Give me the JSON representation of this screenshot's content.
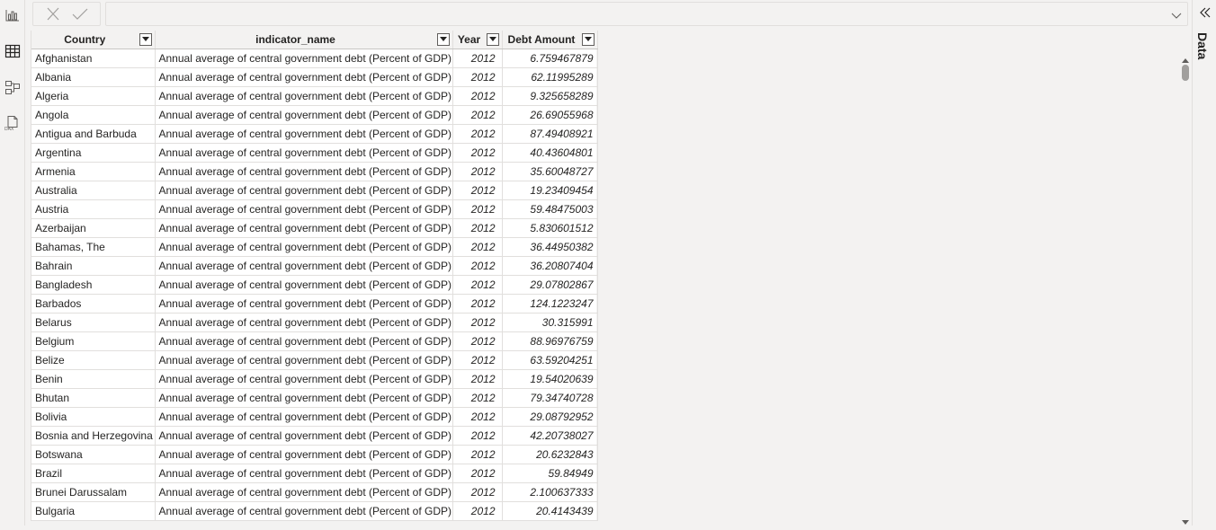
{
  "left_nav": {
    "items": [
      {
        "icon": "report-view-icon"
      },
      {
        "icon": "table-view-icon"
      },
      {
        "icon": "model-view-icon"
      },
      {
        "icon": "dax-query-view-icon"
      }
    ]
  },
  "formula_bar": {
    "value": ""
  },
  "table": {
    "columns": [
      "Country",
      "indicator_name",
      "Year",
      "Debt Amount"
    ],
    "rows": [
      [
        "Afghanistan",
        "Annual average of central government debt (Percent of GDP)",
        "2012",
        "6.759467879"
      ],
      [
        "Albania",
        "Annual average of central government debt (Percent of GDP)",
        "2012",
        "62.11995289"
      ],
      [
        "Algeria",
        "Annual average of central government debt (Percent of GDP)",
        "2012",
        "9.325658289"
      ],
      [
        "Angola",
        "Annual average of central government debt (Percent of GDP)",
        "2012",
        "26.69055968"
      ],
      [
        "Antigua and Barbuda",
        "Annual average of central government debt (Percent of GDP)",
        "2012",
        "87.49408921"
      ],
      [
        "Argentina",
        "Annual average of central government debt (Percent of GDP)",
        "2012",
        "40.43604801"
      ],
      [
        "Armenia",
        "Annual average of central government debt (Percent of GDP)",
        "2012",
        "35.60048727"
      ],
      [
        "Australia",
        "Annual average of central government debt (Percent of GDP)",
        "2012",
        "19.23409454"
      ],
      [
        "Austria",
        "Annual average of central government debt (Percent of GDP)",
        "2012",
        "59.48475003"
      ],
      [
        "Azerbaijan",
        "Annual average of central government debt (Percent of GDP)",
        "2012",
        "5.830601512"
      ],
      [
        "Bahamas, The",
        "Annual average of central government debt (Percent of GDP)",
        "2012",
        "36.44950382"
      ],
      [
        "Bahrain",
        "Annual average of central government debt (Percent of GDP)",
        "2012",
        "36.20807404"
      ],
      [
        "Bangladesh",
        "Annual average of central government debt (Percent of GDP)",
        "2012",
        "29.07802867"
      ],
      [
        "Barbados",
        "Annual average of central government debt (Percent of GDP)",
        "2012",
        "124.1223247"
      ],
      [
        "Belarus",
        "Annual average of central government debt (Percent of GDP)",
        "2012",
        "30.315991"
      ],
      [
        "Belgium",
        "Annual average of central government debt (Percent of GDP)",
        "2012",
        "88.96976759"
      ],
      [
        "Belize",
        "Annual average of central government debt (Percent of GDP)",
        "2012",
        "63.59204251"
      ],
      [
        "Benin",
        "Annual average of central government debt (Percent of GDP)",
        "2012",
        "19.54020639"
      ],
      [
        "Bhutan",
        "Annual average of central government debt (Percent of GDP)",
        "2012",
        "79.34740728"
      ],
      [
        "Bolivia",
        "Annual average of central government debt (Percent of GDP)",
        "2012",
        "29.08792952"
      ],
      [
        "Bosnia and Herzegovina",
        "Annual average of central government debt (Percent of GDP)",
        "2012",
        "42.20738027"
      ],
      [
        "Botswana",
        "Annual average of central government debt (Percent of GDP)",
        "2012",
        "20.6232843"
      ],
      [
        "Brazil",
        "Annual average of central government debt (Percent of GDP)",
        "2012",
        "59.84949"
      ],
      [
        "Brunei Darussalam",
        "Annual average of central government debt (Percent of GDP)",
        "2012",
        "2.100637333"
      ],
      [
        "Bulgaria",
        "Annual average of central government debt (Percent of GDP)",
        "2012",
        "20.4143439"
      ]
    ]
  },
  "right_pane": {
    "label": "Data"
  }
}
